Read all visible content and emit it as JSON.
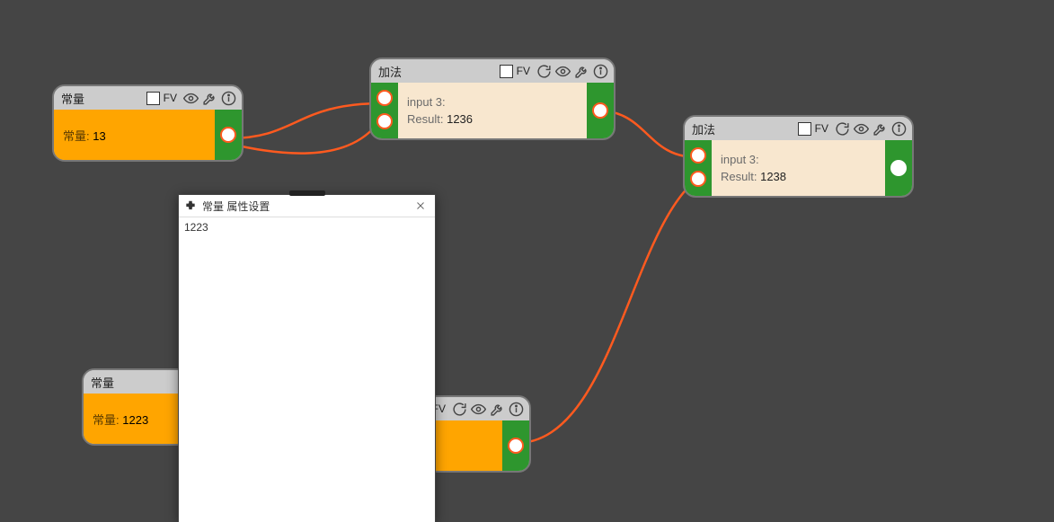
{
  "colors": {
    "canvas_bg": "#454545",
    "node_border": "#777777",
    "node_header_bg": "#cccccc",
    "node_body_orange": "#ffa500",
    "node_body_pale": "#f8e7cf",
    "port_strip_green": "#2e962e",
    "connection": "#ff5a1f"
  },
  "fv_label": "FV",
  "icons": {
    "refresh": "refresh-icon",
    "eye": "eye-icon",
    "wrench": "wrench-icon",
    "info": "info-icon",
    "close": "close-icon",
    "puzzle": "puzzle-icon"
  },
  "nodes": {
    "const1": {
      "title": "常量",
      "label": "常量:",
      "value": "13",
      "fv_checked": false,
      "header_icons": [
        "eye",
        "wrench",
        "info"
      ]
    },
    "add1": {
      "title": "加法",
      "fv_checked": false,
      "header_icons": [
        "refresh",
        "eye",
        "wrench",
        "info"
      ],
      "rows": [
        {
          "label": "input 3:",
          "value": ""
        },
        {
          "label": "Result:",
          "value": "1236"
        }
      ]
    },
    "add2": {
      "title": "加法",
      "fv_checked": false,
      "header_icons": [
        "refresh",
        "eye",
        "wrench",
        "info"
      ],
      "rows": [
        {
          "label": "input 3:",
          "value": ""
        },
        {
          "label": "Result:",
          "value": "1238"
        }
      ]
    },
    "const2": {
      "title": "常量",
      "label": "常量:",
      "value": "1223",
      "fv_checked": false,
      "header_icons_visible": [
        "eye",
        "wrench",
        "info"
      ]
    },
    "hidden_add": {
      "fv_checked": false,
      "header_icons": [
        "refresh",
        "eye",
        "wrench",
        "info"
      ]
    }
  },
  "dialog": {
    "title": "常量 属性设置",
    "content": "1223"
  }
}
